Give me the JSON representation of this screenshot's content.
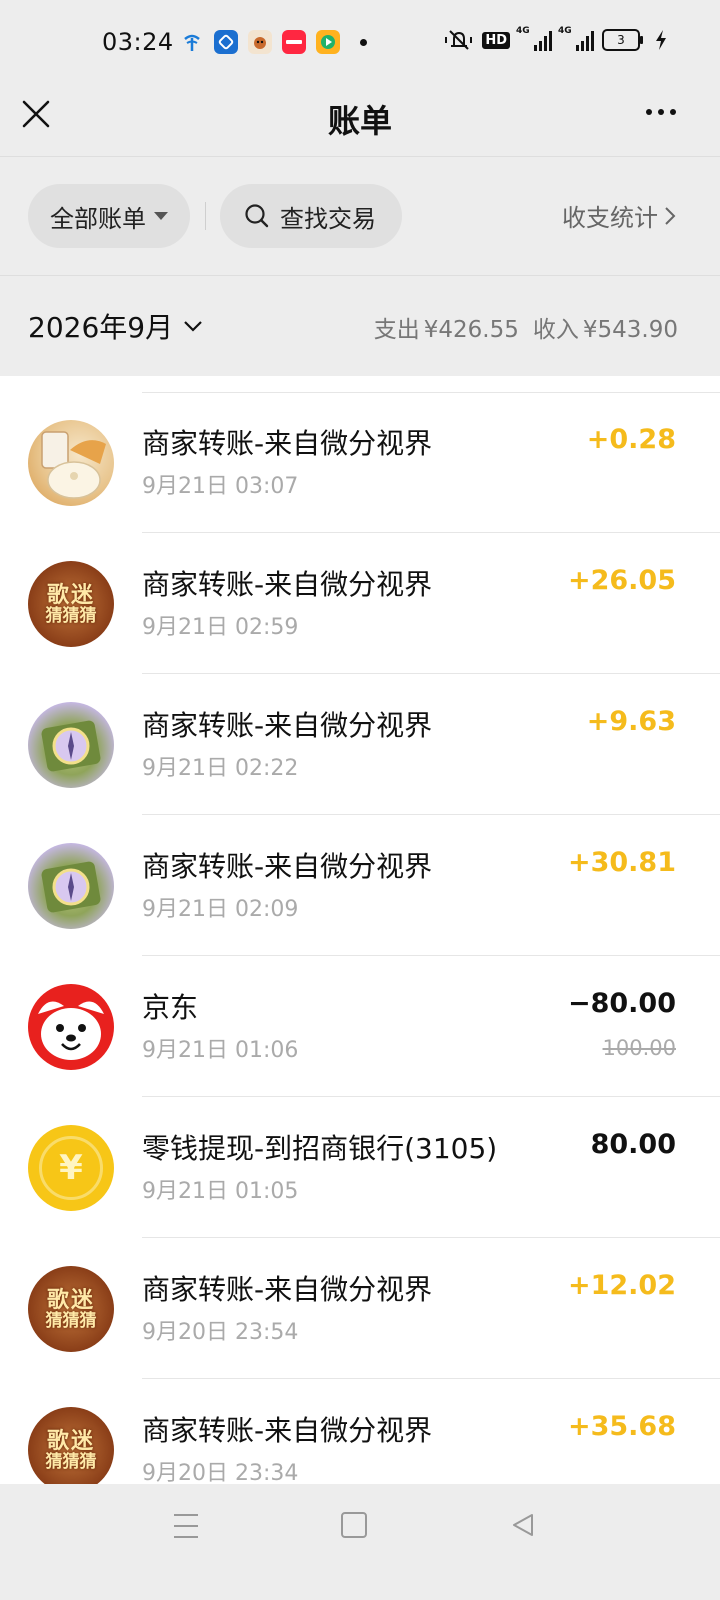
{
  "status_bar": {
    "time": "03:24",
    "notification_icons": [
      "china-telecom-icon",
      "bank-app-icon",
      "pet-app-icon",
      "xiaohongshu-icon",
      "video-app-icon"
    ],
    "system_icons": [
      "mute-icon",
      "hd-icon",
      "signal-4g-icon",
      "signal-4g-icon",
      "battery-icon",
      "charging-icon"
    ],
    "hd_label": "HD",
    "net_label": "4G",
    "battery_level": "3"
  },
  "header": {
    "title": "账单"
  },
  "filters": {
    "all_bills": "全部账单",
    "search": "查找交易",
    "stats": "收支统计"
  },
  "month": {
    "label": "2026年9月",
    "expense_label": "支出",
    "expense_value": "¥426.55",
    "income_label": "收入",
    "income_value": "¥543.90"
  },
  "transactions": [
    {
      "title": "商家转账-来自微分视界",
      "time": "9月21日 03:07",
      "amount": "+0.28",
      "type": "income",
      "avatar": "food"
    },
    {
      "title": "商家转账-来自微分视界",
      "time": "9月21日 02:59",
      "amount": "+26.05",
      "type": "income",
      "avatar": "game"
    },
    {
      "title": "商家转账-来自微分视界",
      "time": "9月21日 02:22",
      "amount": "+9.63",
      "type": "income",
      "avatar": "map"
    },
    {
      "title": "商家转账-来自微分视界",
      "time": "9月21日 02:09",
      "amount": "+30.81",
      "type": "income",
      "avatar": "map"
    },
    {
      "title": "京东",
      "time": "9月21日 01:06",
      "amount": "−80.00",
      "original": "100.00",
      "type": "expense",
      "avatar": "jd"
    },
    {
      "title": "零钱提现-到招商银行(3105)",
      "time": "9月21日 01:05",
      "amount": "80.00",
      "type": "transfer",
      "avatar": "coin"
    },
    {
      "title": "商家转账-来自微分视界",
      "time": "9月20日 23:54",
      "amount": "+12.02",
      "type": "income",
      "avatar": "game"
    },
    {
      "title": "商家转账-来自微分视界",
      "time": "9月20日 23:34",
      "amount": "+35.68",
      "type": "income",
      "avatar": "game"
    }
  ],
  "avatar_text": {
    "game_line1": "歌迷",
    "game_line2": "猜猜猜",
    "coin_symbol": "¥"
  },
  "colors": {
    "income": "#f5bb1c",
    "expense": "#111111",
    "background": "#ededed"
  }
}
